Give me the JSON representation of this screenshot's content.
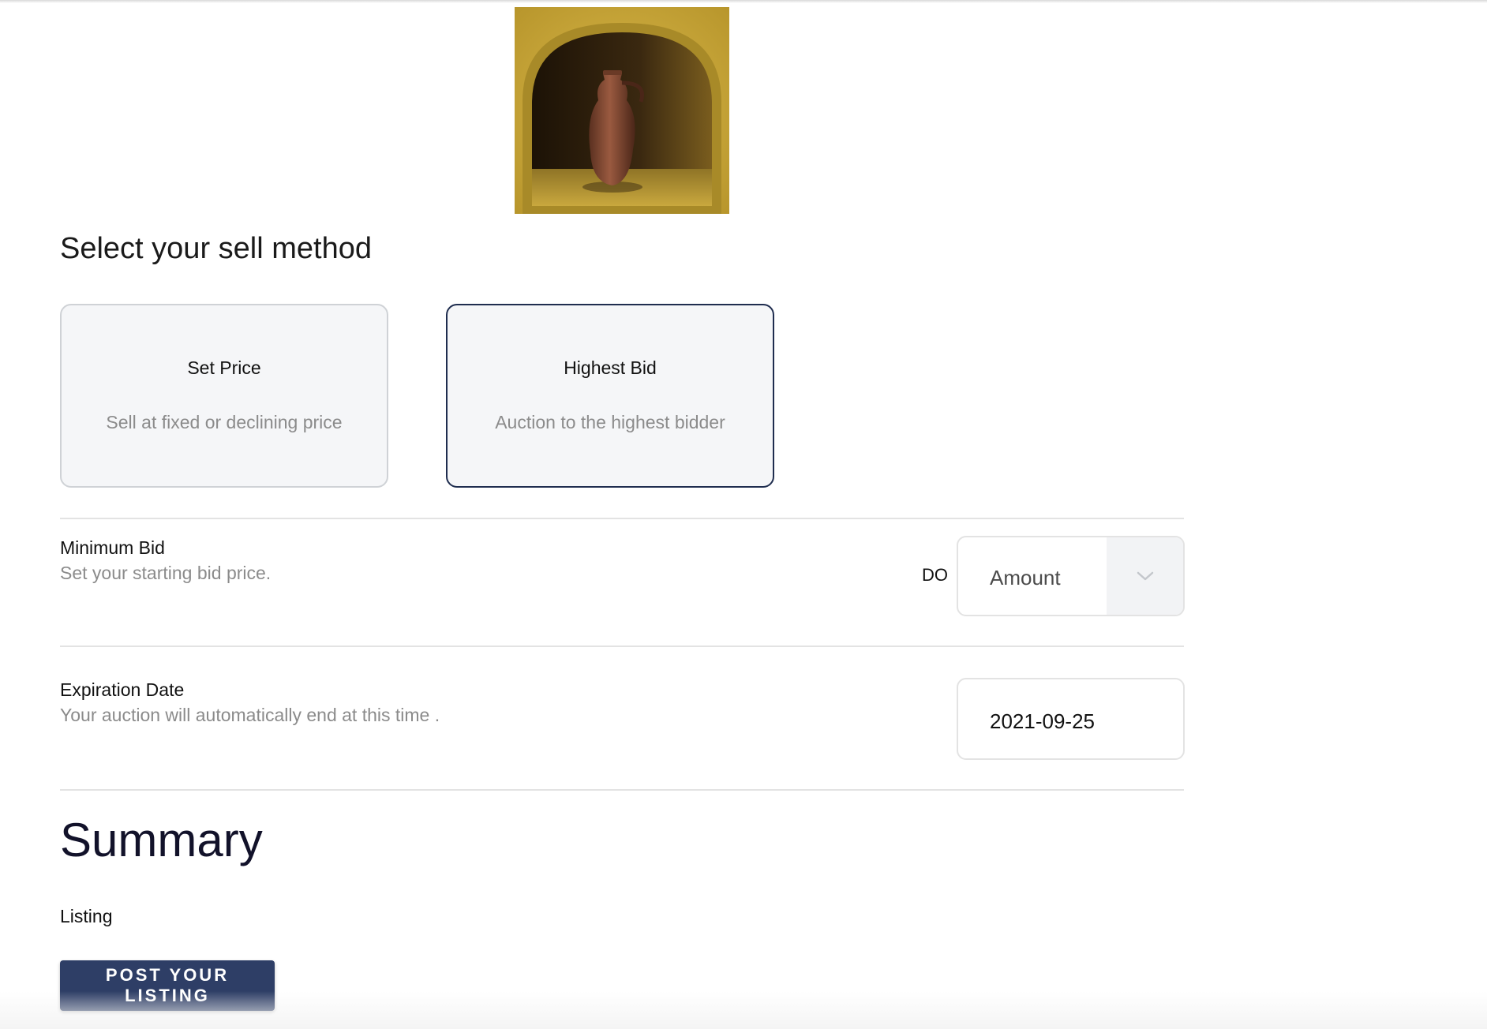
{
  "sell_method": {
    "heading": "Select your sell method",
    "options": [
      {
        "title": "Set Price",
        "description": "Sell at fixed or declining price",
        "selected": false
      },
      {
        "title": "Highest Bid",
        "description": "Auction to the highest bidder",
        "selected": true
      }
    ]
  },
  "minimum_bid": {
    "label": "Minimum Bid",
    "help": "Set your starting bid price.",
    "currency": "DO",
    "amount_placeholder": "Amount"
  },
  "expiration": {
    "label": "Expiration Date",
    "help": "Your auction will automatically end at this time .",
    "value": "2021-09-25"
  },
  "summary": {
    "heading": "Summary",
    "listing_label": "Listing",
    "post_button": "POST YOUR LISTING"
  },
  "colors": {
    "primary": "#2e3e66",
    "selected_border": "#1f2d4f",
    "card_background": "#f5f6f8",
    "muted_text": "#8b8b8b"
  },
  "icons": {
    "select_chevron": "chevron-down-icon"
  }
}
